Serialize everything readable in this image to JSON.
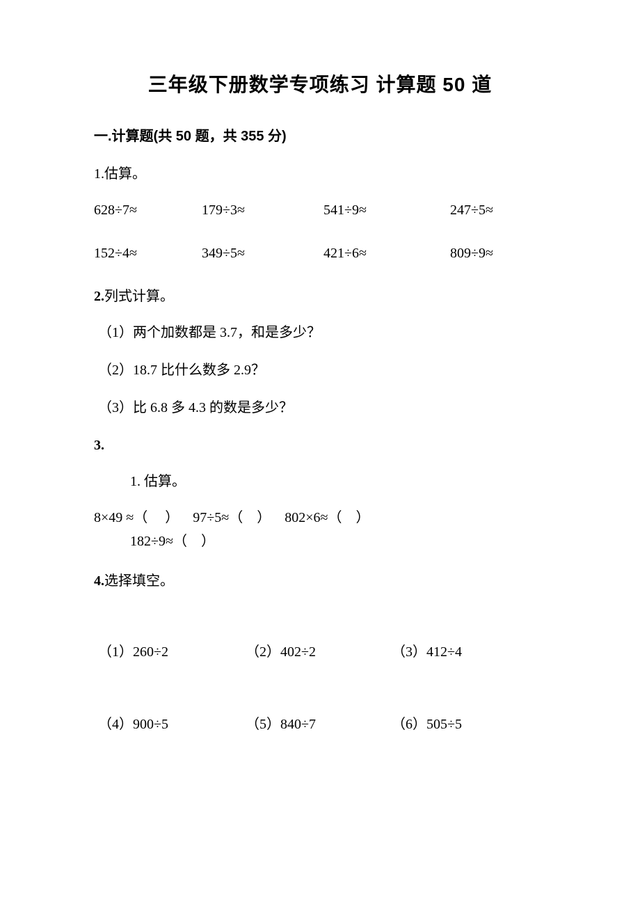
{
  "title": "三年级下册数学专项练习 计算题 50 道",
  "section_header": "一.计算题(共 50 题，共 355 分)",
  "p1": {
    "header_num": "1.",
    "header_label": "估算。",
    "items": [
      "628÷7≈",
      "179÷3≈",
      "541÷9≈",
      "247÷5≈",
      "152÷4≈",
      "349÷5≈",
      "421÷6≈",
      "809÷9≈"
    ]
  },
  "p2": {
    "header_num": "2.",
    "header_label": "列式计算。",
    "subs": [
      "（1）两个加数都是 3.7，和是多少？",
      "（2）18.7 比什么数多 2.9？",
      "（3）比 6.8 多 4.3 的数是多少？"
    ]
  },
  "p3": {
    "header_num": "3.",
    "sub_header_num": "1.",
    "sub_header_label": " 估算。",
    "line1": "8×49 ≈（     ）    97÷5≈（    ）    802×6≈（    ）",
    "line2": "182÷9≈（    ）"
  },
  "p4": {
    "header_num": "4.",
    "header_label": "选择填空。",
    "rows": [
      [
        "（1）260÷2",
        "（2）402÷2",
        "（3）412÷4"
      ],
      [
        "（4）900÷5",
        "（5）840÷7",
        "（6）505÷5"
      ]
    ]
  }
}
